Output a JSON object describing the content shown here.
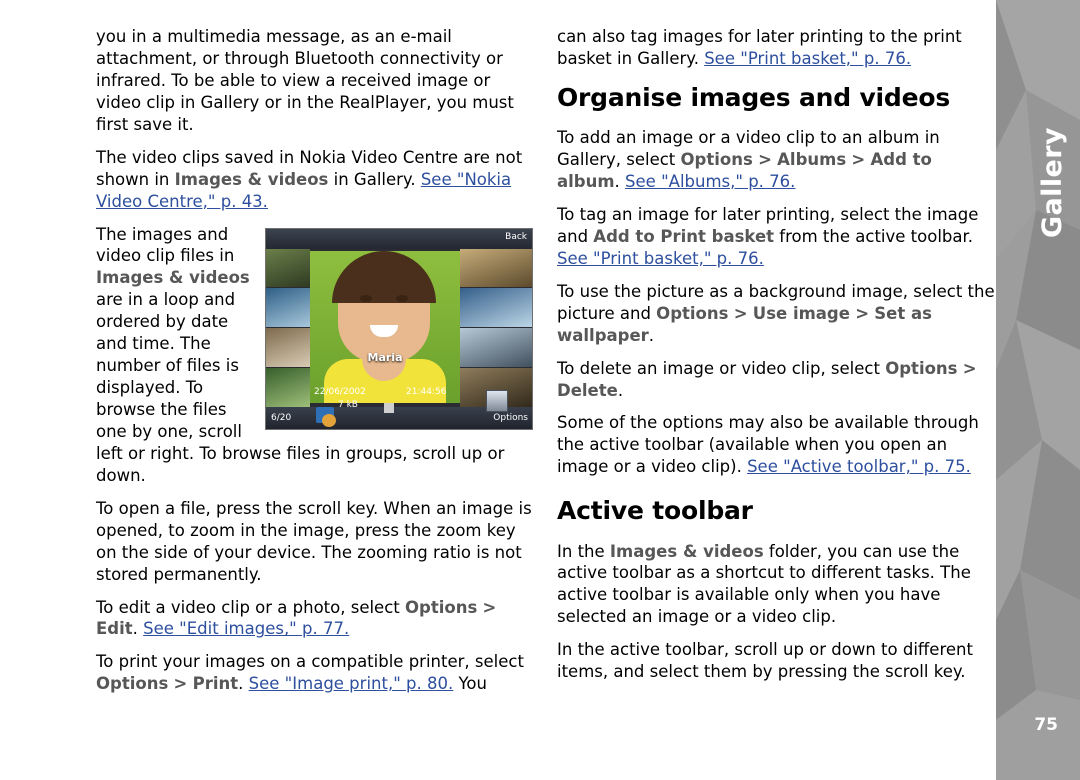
{
  "side": {
    "chapter_title": "Gallery",
    "page_number": "75"
  },
  "left_column": {
    "p1": "you in a multimedia message, as an e-mail attachment, or through Bluetooth connectivity or infrared. To be able to view a received image or video clip in Gallery or in the RealPlayer, you must first save it.",
    "p2_a": "The video clips saved in Nokia Video Centre are not shown in ",
    "p2_ui1": "Images & videos",
    "p2_b": " in Gallery. ",
    "p2_link": "See \"Nokia Video Centre,\" p. 43.",
    "p3_a": "The images and video clip files in ",
    "p3_ui1": "Images & videos",
    "p3_b": " are in a loop and ordered by date and time. The number of files is displayed. To browse the files one by one, scroll left or right. To browse files in groups, scroll up or down.",
    "p4": "To open a file, press the scroll key. When an image is opened, to zoom in the image, press the zoom key on the side of your device. The zooming ratio is not stored permanently.",
    "p5_a": "To edit a video clip or a photo, select ",
    "p5_ui1": "Options",
    "p5_arrow": ">",
    "p5_ui2": "Edit",
    "p5_b": ". ",
    "p5_link": "See \"Edit images,\" p. 77.",
    "p6_a": "To print your images on a compatible printer, select ",
    "p6_ui1": "Options",
    "p6_arrow": ">",
    "p6_ui2": "Print",
    "p6_b": ". ",
    "p6_link": "See \"Image print,\" p. 80.",
    "p6_c": " You"
  },
  "figure": {
    "back_label": "Back",
    "options_label": "Options",
    "counter_label": "6/20",
    "name_label": "Maria",
    "date_label": "22/06/2002",
    "time_label": "21:44:56",
    "size_label": "7 kB"
  },
  "right_column": {
    "p1_a": "can also tag images for later printing to the print basket in Gallery. ",
    "p1_link": "See \"Print basket,\" p. 76.",
    "h1": "Organise images and videos",
    "p2_a": "To add an image or a video clip to an album in Gallery, select ",
    "p2_ui1": "Options",
    "p2_arrow1": ">",
    "p2_ui2": "Albums",
    "p2_arrow2": ">",
    "p2_ui3": "Add to album",
    "p2_b": ". ",
    "p2_link": "See \"Albums,\" p. 76.",
    "p3_a": "To tag an image for later printing, select the image and ",
    "p3_ui1": "Add to Print basket",
    "p3_b": " from the active toolbar. ",
    "p3_link": "See \"Print basket,\" p. 76.",
    "p4_a": "To use the picture as a background image, select the picture and ",
    "p4_ui1": "Options",
    "p4_arrow1": ">",
    "p4_ui2": "Use image",
    "p4_arrow2": ">",
    "p4_ui3": "Set as wallpaper",
    "p4_b": ".",
    "p5_a": "To delete an image or video clip, select ",
    "p5_ui1": "Options",
    "p5_arrow1": ">",
    "p5_ui2": "Delete",
    "p5_b": ".",
    "p6_a": "Some of the options may also be available through the active toolbar (available when you open an image or a video clip). ",
    "p6_link": "See \"Active toolbar,\" p. 75.",
    "h2": "Active toolbar",
    "p7_a": "In the ",
    "p7_ui1": "Images & videos",
    "p7_b": " folder, you can use the active toolbar as a shortcut to different tasks. The active toolbar is available only when you have selected an image or a video clip.",
    "p8": "In the active toolbar, scroll up or down to different items, and select them by pressing the scroll key."
  },
  "colors": {
    "link": "#2d4f9e",
    "ui_text": "#575757",
    "band": "#9a9a9a"
  }
}
